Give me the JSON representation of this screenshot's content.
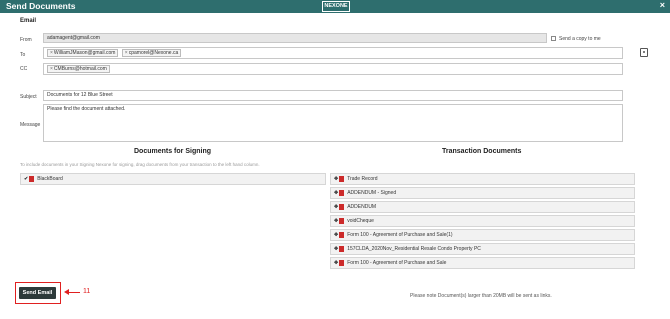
{
  "header": {
    "title": "Send Documents",
    "logo": "NEXONE",
    "close_label": "×"
  },
  "email": {
    "section_title": "Email",
    "from_label": "From",
    "from_value": "adamagent@gmail.com",
    "send_copy_label": "Send a copy to me",
    "to_label": "To",
    "to_recipients": [
      "WilliamJMason@gmail.com",
      "cpamorel@Nexone.ca"
    ],
    "cc_label": "CC",
    "cc_recipients": [
      "CMBurns@hotmail.com"
    ],
    "subject_label": "Subject",
    "subject_value": "Documents for 12 Blue Street",
    "message_label": "Message",
    "message_value": "Please find the document attached."
  },
  "signing": {
    "title": "Documents for Signing",
    "hint": "To include documents in your Signing Nexone for signing, drag documents from your transaction to the left hand column.",
    "items": [
      "BlackBoard"
    ]
  },
  "transaction": {
    "title": "Transaction Documents",
    "items": [
      "Trade Record",
      "ADDENDUM - Signed",
      "ADDENDUM",
      "voidCheque",
      "Form 100 - Agreement of Purchase and Sale(1)",
      "157CLDA_2020Nov_Residential Resale Condo Property PC",
      "Form 100 - Agreement of Purchase and Sale"
    ]
  },
  "footer": {
    "send_label": "Send Email",
    "step_number": "11",
    "note": "Please note Document(s) larger than 20MB will be sent as links."
  },
  "colors": {
    "header_bg": "#2e6e6e",
    "highlight": "#e02020",
    "button_bg": "#2d3a3a"
  }
}
